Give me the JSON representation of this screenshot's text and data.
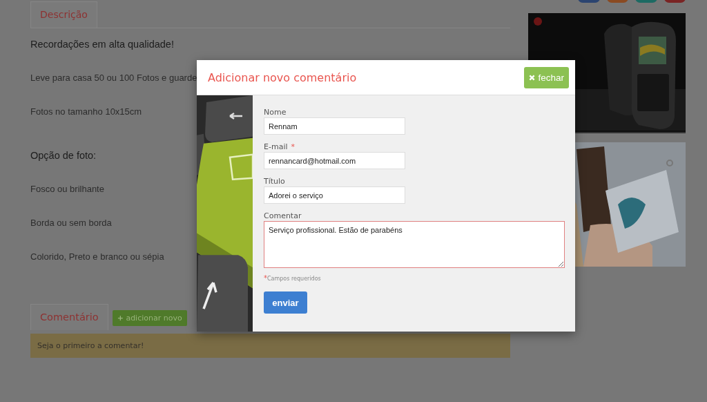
{
  "page": {
    "description_tab": {
      "label": "Descrição",
      "selected": true
    },
    "paragraphs": [
      {
        "kind": "heading",
        "text": "Recordações em alta qualidade!"
      },
      {
        "kind": "text",
        "text": "Leve para casa 50 ou 100 Fotos e guarde"
      },
      {
        "kind": "text",
        "text": "Fotos no tamanho 10x15cm"
      },
      {
        "kind": "heading",
        "text": "Opção de foto:"
      },
      {
        "kind": "text",
        "text": "Fosco ou brilhante"
      },
      {
        "kind": "text",
        "text": "Borda ou sem borda"
      },
      {
        "kind": "text",
        "text": "Colorido, Preto e branco ou sépia"
      }
    ],
    "comments_tab": {
      "label": "Comentário",
      "selected": true
    },
    "add_button": {
      "icon": "+",
      "label": "adicionar novo"
    },
    "empty_notice": "Seja o primeiro a comentar!"
  },
  "modal": {
    "title": "Adicionar novo comentário",
    "close_button": "fechar",
    "fields": [
      {
        "kind": "input",
        "label": "Nome",
        "value": "Rennam"
      },
      {
        "kind": "input",
        "label": "E-mail",
        "required_mark": "*",
        "value": "rennancard@hotmail.com"
      },
      {
        "kind": "input",
        "label": "Título",
        "value": "Adorei o serviço"
      },
      {
        "kind": "textarea",
        "label": "Comentar",
        "value": "Serviço profissional. Estão de parabéns"
      }
    ],
    "footnote": {
      "mark": "*",
      "text": "Campos requeridos"
    },
    "submit_button": "enviar"
  }
}
